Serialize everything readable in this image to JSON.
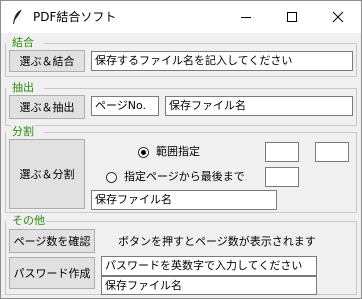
{
  "window": {
    "title": "PDF結合ソフト"
  },
  "groups": {
    "merge": {
      "legend": "結合",
      "button": "選ぶ＆結合",
      "filename": "保存するファイル名を記入してください"
    },
    "extract": {
      "legend": "抽出",
      "button": "選ぶ＆抽出",
      "page_no": "ページNo.",
      "filename": "保存ファイル名"
    },
    "split": {
      "legend": "分割",
      "button": "選ぶ＆分割",
      "options": [
        {
          "label": "範囲指定",
          "checked": true
        },
        {
          "label": "指定ページから最後まで",
          "checked": false
        }
      ],
      "range_from": "",
      "range_to": "",
      "from_page": "",
      "filename": "保存ファイル名"
    },
    "other": {
      "legend": "その他",
      "page_count_button": "ページ数を確認",
      "page_count_message": "ボタンを押すとページ数が表示されます",
      "password_button": "パスワード作成",
      "password": "パスワードを英数字で入力してください",
      "filename": "保存ファイル名"
    }
  }
}
